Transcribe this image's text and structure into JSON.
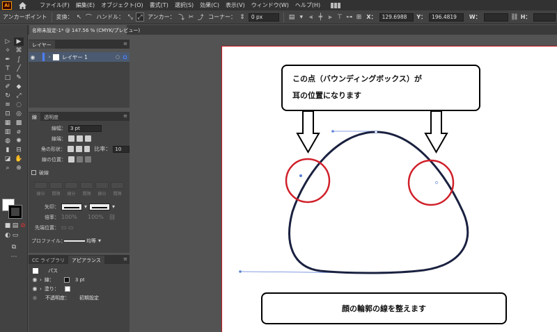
{
  "app": {
    "logo": "Ai"
  },
  "menu": [
    "ファイル(F)",
    "編集(E)",
    "オブジェクト(O)",
    "書式(T)",
    "選択(S)",
    "効果(C)",
    "表示(V)",
    "ウィンドウ(W)",
    "ヘルプ(H)"
  ],
  "control": {
    "mode_label": "アンカーポイント",
    "convert_label": "変換：",
    "handle_label": "ハンドル：",
    "anchor_label": "アンカー：",
    "corner_label": "コーナー：",
    "corner_value": "0 px",
    "x_label": "X：",
    "x_value": "129.6988",
    "y_label": "Y：",
    "y_value": "196.4819",
    "w_label": "W：",
    "h_label": "H："
  },
  "document": {
    "tab_label": "名称未設定-1* @ 147.56 % (CMYK/プレビュー)"
  },
  "layers": {
    "tab": "レイヤー",
    "layer_name": "レイヤー 1"
  },
  "stroke": {
    "tab_stroke": "線",
    "tab_transparency": "透明度",
    "weight_label": "線幅：",
    "weight_value": "3 pt",
    "cap_label": "線端：",
    "corner_label": "角の形状：",
    "limit_label": "比率：",
    "limit_value": "10",
    "align_label": "線の位置：",
    "dashed_label": "破線",
    "dash_labels": [
      "線分",
      "間隔",
      "線分",
      "間隔",
      "線分",
      "間隔"
    ],
    "arrow_label": "矢印：",
    "scale_label": "倍率：",
    "scale_value_1": "100%",
    "scale_value_2": "100%",
    "align_arrow_label": "先端位置：",
    "profile_label": "プロファイル：",
    "profile_value": "均等"
  },
  "appearance": {
    "tab_cc": "CC ライブラリ",
    "tab_appearance": "アピアランス",
    "object": "パス",
    "stroke_label": "線：",
    "stroke_value": "3 pt",
    "fill_label": "塗り：",
    "opacity_label": "不透明度：",
    "opacity_value": "初期設定"
  },
  "callouts": {
    "top_line1": "この点（バウンディングボックス）が",
    "top_line2": "耳の位置になります",
    "bottom": "顔の輪郭の線を整えます"
  },
  "colors": {
    "accent_red": "#d0202a",
    "path_navy": "#1a2140",
    "handle_blue": "#5b7fd6",
    "layer_blue": "#4f7fff"
  }
}
